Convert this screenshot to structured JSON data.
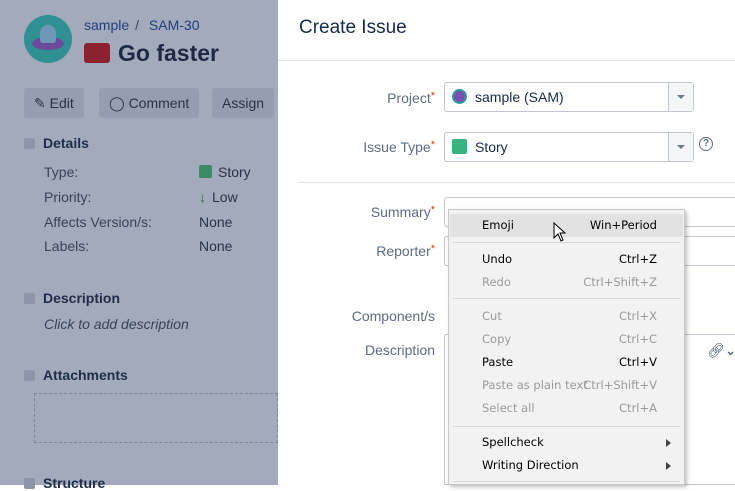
{
  "issue": {
    "project": "sample",
    "key": "SAM-30",
    "title": "Go faster",
    "actions": [
      "Edit",
      "Comment",
      "Assign"
    ],
    "details_heading": "Details",
    "fields": [
      {
        "label": "Type:",
        "value": "Story"
      },
      {
        "label": "Priority:",
        "value": "Low"
      },
      {
        "label": "Affects Version/s:",
        "value": "None"
      },
      {
        "label": "Labels:",
        "value": "None"
      }
    ],
    "description_heading": "Description",
    "description_placeholder": "Click to add description",
    "attachments_heading": "Attachments",
    "structure_heading": "Structure"
  },
  "modal": {
    "title": "Create Issue",
    "project_label": "Project",
    "project_value": "sample (SAM)",
    "issue_type_label": "Issue Type",
    "issue_type_value": "Story",
    "summary_label": "Summary",
    "reporter_label": "Reporter",
    "components_label": "Component/s",
    "description_label": "Description",
    "required": "*"
  },
  "context_menu": [
    {
      "label": "Emoji",
      "key": "Win+Period",
      "state": "highlighted"
    },
    {
      "label": "Undo",
      "key": "Ctrl+Z",
      "state": "enabled"
    },
    {
      "label": "Redo",
      "key": "Ctrl+Shift+Z",
      "state": "disabled"
    },
    {
      "label": "Cut",
      "key": "Ctrl+X",
      "state": "disabled"
    },
    {
      "label": "Copy",
      "key": "Ctrl+C",
      "state": "disabled"
    },
    {
      "label": "Paste",
      "key": "Ctrl+V",
      "state": "enabled"
    },
    {
      "label": "Paste as plain text",
      "key": "Ctrl+Shift+V",
      "state": "disabled"
    },
    {
      "label": "Select all",
      "key": "Ctrl+A",
      "state": "disabled"
    },
    {
      "label": "Spellcheck",
      "key": "",
      "state": "submenu"
    },
    {
      "label": "Writing Direction",
      "key": "",
      "state": "submenu"
    }
  ]
}
